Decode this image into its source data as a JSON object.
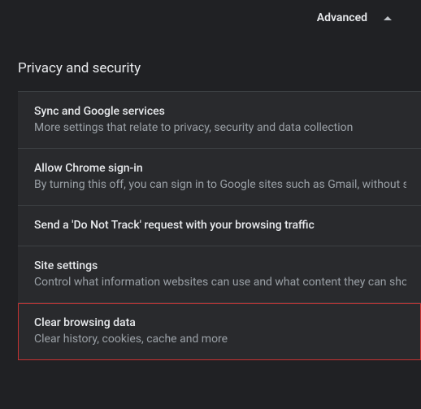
{
  "header": {
    "advanced_label": "Advanced"
  },
  "section": {
    "title": "Privacy and security"
  },
  "items": [
    {
      "title": "Sync and Google services",
      "desc": "More settings that relate to privacy, security and data collection"
    },
    {
      "title": "Allow Chrome sign-in",
      "desc": "By turning this off, you can sign in to Google sites such as Gmail, without signing in to Chrome"
    },
    {
      "title": "Send a 'Do Not Track' request with your browsing traffic",
      "desc": ""
    },
    {
      "title": "Site settings",
      "desc": "Control what information websites can use and what content they can show you"
    },
    {
      "title": "Clear browsing data",
      "desc": "Clear history, cookies, cache and more"
    }
  ]
}
